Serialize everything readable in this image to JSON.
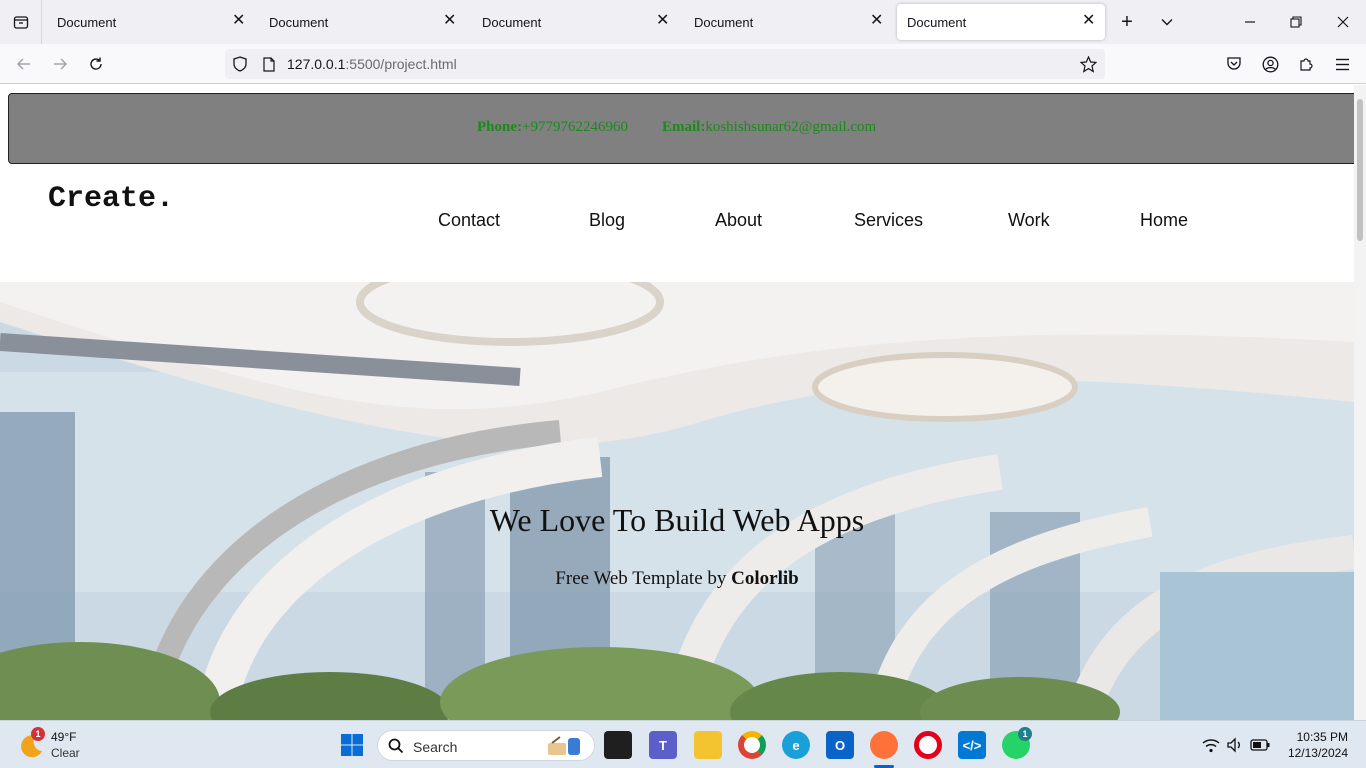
{
  "browser": {
    "tabs": [
      {
        "title": "Document"
      },
      {
        "title": "Document"
      },
      {
        "title": "Document"
      },
      {
        "title": "Document"
      },
      {
        "title": "Document"
      }
    ],
    "url_host": "127.0.0.1",
    "url_path": ":5500/project.html"
  },
  "page": {
    "contact": {
      "phone_label": "Phone:",
      "phone_value": "+9779762246960",
      "email_label": "Email:",
      "email_value": "koshishsunar62@gmail.com"
    },
    "logo": "Create.",
    "menu": [
      "Contact",
      "Blog",
      "About",
      "Services",
      "Work",
      "Home"
    ],
    "hero": {
      "title": "We Love To Build Web Apps",
      "subtitle_prefix": "Free Web Template by ",
      "subtitle_brand": "Colorlib"
    }
  },
  "taskbar": {
    "weather_temp": "49°F",
    "weather_cond": "Clear",
    "weather_badge": "1",
    "search_label": "Search",
    "whatsapp_badge": "1",
    "time": "10:35 PM",
    "date": "12/13/2024"
  }
}
